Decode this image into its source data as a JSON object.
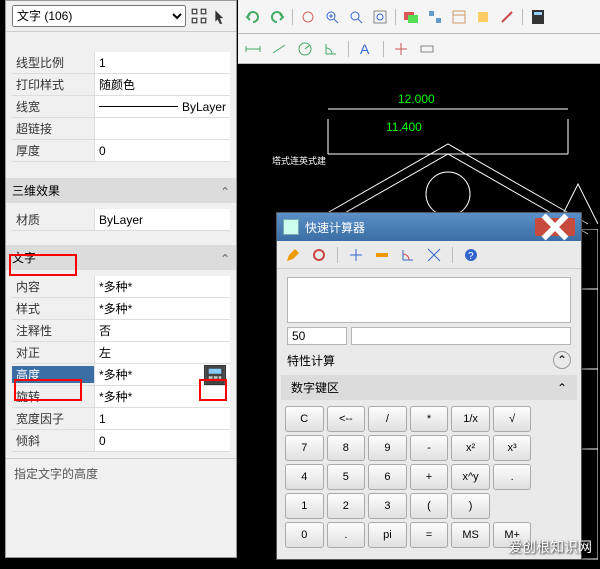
{
  "panel": {
    "selector": "文字 (106)",
    "group_general": {
      "line_scale": {
        "label": "线型比例",
        "value": "1"
      },
      "plot_style": {
        "label": "打印样式",
        "value": "随颜色"
      },
      "lineweight": {
        "label": "线宽",
        "value": "ByLayer"
      },
      "hyperlink": {
        "label": "超链接",
        "value": ""
      },
      "thickness": {
        "label": "厚度",
        "value": "0"
      }
    },
    "section_3d": {
      "title": "三维效果"
    },
    "group_3d": {
      "material": {
        "label": "材质",
        "value": "ByLayer"
      }
    },
    "section_text": {
      "title": "文字"
    },
    "group_text": {
      "content": {
        "label": "内容",
        "value": "*多种*"
      },
      "style": {
        "label": "样式",
        "value": "*多种*"
      },
      "annotative": {
        "label": "注释性",
        "value": "否"
      },
      "justify": {
        "label": "对正",
        "value": "左"
      },
      "height": {
        "label": "高度",
        "value": "*多种*"
      },
      "rotation": {
        "label": "旋转",
        "value": "*多种*"
      },
      "width_factor": {
        "label": "宽度因子",
        "value": "1"
      },
      "oblique": {
        "label": "倾斜",
        "value": "0"
      }
    },
    "hint": "指定文字的高度"
  },
  "canvas": {
    "dim1": "12.000",
    "dim2": "11.400",
    "label": "塔式连英式建"
  },
  "qcalc": {
    "title": "快速计算器",
    "result": "50",
    "prop_label": "特性计算",
    "keypad_title": "数字键区",
    "keys": [
      [
        "C",
        "<--",
        "/",
        "*",
        "1/x",
        "√",
        ""
      ],
      [
        "7",
        "8",
        "9",
        "-",
        "x²",
        "x³",
        ""
      ],
      [
        "4",
        "5",
        "6",
        "+",
        "x^y",
        ".",
        ""
      ],
      [
        "1",
        "2",
        "3",
        "(",
        ")",
        "",
        ""
      ],
      [
        "0",
        ".",
        "pi",
        "=",
        "MS",
        "M+",
        ""
      ]
    ]
  },
  "watermark": "爱创根知识网"
}
